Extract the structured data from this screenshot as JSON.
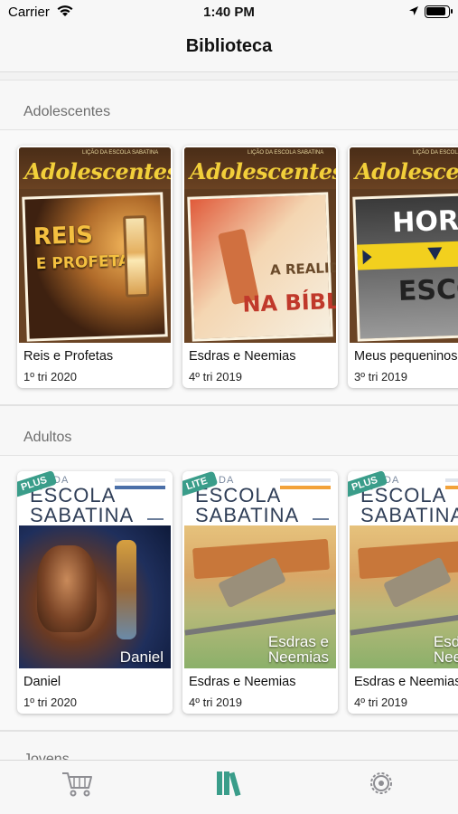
{
  "status": {
    "carrier": "Carrier",
    "time": "1:40 PM"
  },
  "nav": {
    "title": "Biblioteca"
  },
  "sections": [
    {
      "title": "Adolescentes",
      "items": [
        {
          "title": "Reis e Profetas",
          "subtitle": "1º tri 2020",
          "cover_brand": "Adolescentes",
          "cover_text": "REIS E PROFETAS"
        },
        {
          "title": "Esdras e Neemias",
          "subtitle": "4º tri 2019",
          "cover_brand": "Adolescentes",
          "cover_text": "A REALIDADE NA BÍBLIA"
        },
        {
          "title": "Meus pequeninos",
          "subtitle": "3º tri 2019",
          "cover_brand": "Adolescentes",
          "cover_text": "HORA D ESCOLH"
        }
      ]
    },
    {
      "title": "Adultos",
      "items": [
        {
          "title": "Daniel",
          "subtitle": "1º tri 2020",
          "tag": "PLUS",
          "cover_line1": "ESCOLA",
          "cover_line2": "SABATINA",
          "cover_label": "Daniel"
        },
        {
          "title": "Esdras e Neemias",
          "subtitle": "4º tri 2019",
          "tag": "LITE",
          "cover_line1": "ESCOLA",
          "cover_line2": "SABATINA",
          "cover_label": "Esdras e Neemias"
        },
        {
          "title": "Esdras e Neemias",
          "subtitle": "4º tri 2019",
          "tag": "PLUS",
          "cover_line1": "ESCOLA",
          "cover_line2": "SABATINA",
          "cover_label": "Esdras e Neemias"
        }
      ]
    },
    {
      "title": "Jovens"
    }
  ],
  "tabbar": [
    {
      "icon": "cart-icon",
      "active": false
    },
    {
      "icon": "library-icon",
      "active": true
    },
    {
      "icon": "settings-icon",
      "active": false
    }
  ],
  "colors": {
    "accent": "#3a9d8a",
    "ado_brand": "#f2cf3a",
    "adu_title": "#2f3e57"
  }
}
